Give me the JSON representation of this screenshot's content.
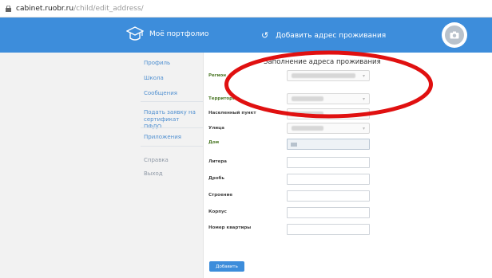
{
  "browser": {
    "url_host": "cabinet.ruobr.ru",
    "url_path": "/child/edit_address/"
  },
  "header": {
    "brand_label": "Моё портфолио",
    "action_label": "Добавить адрес проживания",
    "accent_color": "#3d8ddb"
  },
  "sidebar": {
    "items": [
      {
        "label": "Профиль"
      },
      {
        "label": "Школа"
      },
      {
        "label": "Сообщения"
      },
      {
        "label": "Подать заявку на\nсертификат ПФДО"
      },
      {
        "label": "Приложения"
      },
      {
        "label": "Справка"
      },
      {
        "label": "Выход"
      }
    ]
  },
  "form": {
    "title": "Заполнение адреса проживания",
    "fields": [
      {
        "label": "Регион"
      },
      {
        "label": "Территория"
      },
      {
        "label": "Населенный пункт"
      },
      {
        "label": "Улица"
      },
      {
        "label": "Дом"
      },
      {
        "label": "Литера"
      },
      {
        "label": "Дробь"
      },
      {
        "label": "Строение"
      },
      {
        "label": "Корпус"
      },
      {
        "label": "Номер квартиры"
      }
    ],
    "submit_label": "Добавить"
  },
  "annotation": {
    "color": "#e01010"
  }
}
